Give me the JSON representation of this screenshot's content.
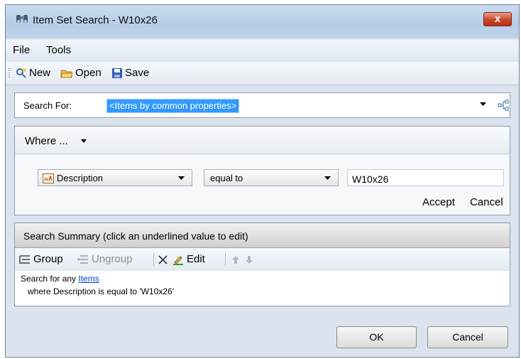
{
  "window": {
    "title": "Item Set Search - W10x26",
    "close_label": "x"
  },
  "menu": {
    "items": [
      "File",
      "Tools"
    ]
  },
  "toolbar": {
    "new_label": "New",
    "open_label": "Open",
    "save_label": "Save"
  },
  "search_for": {
    "label": "Search For:",
    "value": "<Items by common properties>"
  },
  "where": {
    "label": "Where ...",
    "property_value": "Description",
    "operator_value": "equal to",
    "value_input": "W10x26",
    "accept_label": "Accept",
    "cancel_label": "Cancel"
  },
  "summary": {
    "title": "Search Summary (click an underlined value to edit)",
    "group_label": "Group",
    "ungroup_label": "Ungroup",
    "edit_label": "Edit",
    "line1_prefix": "Search for any",
    "line1_link": "Items",
    "line2": "where Description is equal to 'W10x26'"
  },
  "buttons": {
    "ok_label": "OK",
    "cancel_label": "Cancel"
  },
  "colors": {
    "selection": "#3399ff",
    "close": "#c9462b",
    "link": "#0044cc"
  }
}
